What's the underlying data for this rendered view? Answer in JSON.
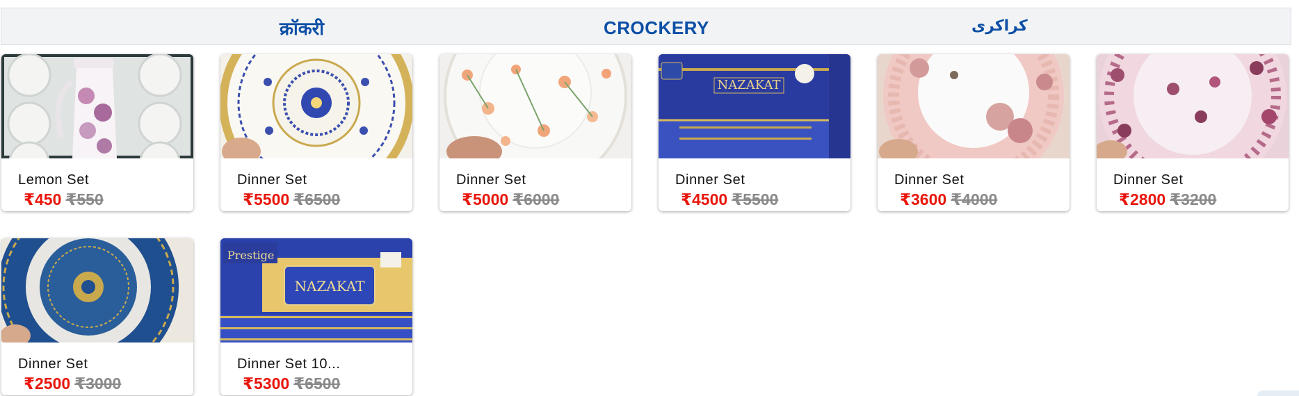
{
  "header": {
    "title_hindi": "क्रॉकरी",
    "title_english": "CROCKERY",
    "title_urdu": "کراکری"
  },
  "colors": {
    "title": "#0d4fa6",
    "price_now": "#e8160c",
    "price_old": "#8a8a8a",
    "header_bg": "#f2f3f5"
  },
  "products": [
    {
      "name": "Lemon Set",
      "price": "₹450",
      "mrp": "₹550",
      "image_icon": "teapot-cups-set-image"
    },
    {
      "name": "Dinner Set",
      "price": "₹5500",
      "mrp": "₹6500",
      "image_icon": "blue-mandala-plate-image"
    },
    {
      "name": "Dinner Set",
      "price": "₹5000",
      "mrp": "₹6000",
      "image_icon": "floral-plate-image"
    },
    {
      "name": "Dinner Set",
      "price": "₹4500",
      "mrp": "₹5500",
      "image_icon": "nazakat-box-image"
    },
    {
      "name": "Dinner Set",
      "price": "₹3600",
      "mrp": "₹4000",
      "image_icon": "rose-pink-plate-image"
    },
    {
      "name": "Dinner Set",
      "price": "₹2800",
      "mrp": "₹3200",
      "image_icon": "pink-lattice-plate-image"
    },
    {
      "name": "Dinner Set",
      "price": "₹2500",
      "mrp": "₹3000",
      "image_icon": "blue-gold-plate-image"
    },
    {
      "name": "Dinner Set 10...",
      "price": "₹5300",
      "mrp": "₹6500",
      "image_icon": "prestige-nazakat-box-image"
    }
  ]
}
